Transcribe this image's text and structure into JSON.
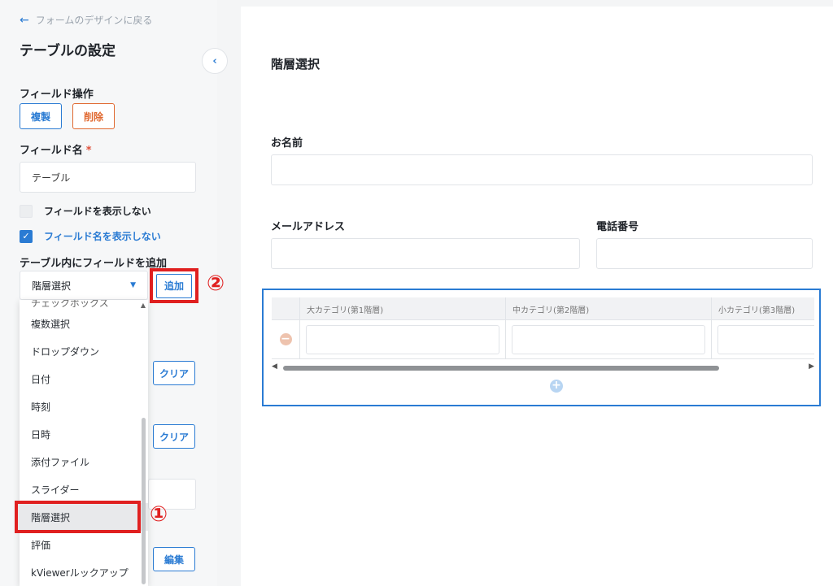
{
  "sidebar": {
    "back_link": "フォームのデザインに戻る",
    "title": "テーブルの設定",
    "field_ops_label": "フィールド操作",
    "duplicate_label": "複製",
    "delete_label": "削除",
    "field_name_label": "フィールド名",
    "required_mark": "*",
    "field_name_value": "テーブル",
    "hide_field_label": "フィールドを表示しない",
    "hide_field_name_label": "フィールド名を表示しない",
    "add_field_label": "テーブル内にフィールドを追加",
    "select_value": "階層選択",
    "add_button": "追加",
    "clear_label": "クリア",
    "edit_label": "編集",
    "dropdown_items": [
      "チェックボックス",
      "複数選択",
      "ドロップダウン",
      "日付",
      "時刻",
      "日時",
      "添付ファイル",
      "スライダー",
      "階層選択",
      "評価",
      "kViewerルックアップ"
    ],
    "annotation_1": "①",
    "annotation_2": "②"
  },
  "form": {
    "title": "階層選択",
    "name_label": "お名前",
    "email_label": "メールアドレス",
    "phone_label": "電話番号",
    "table_columns": [
      "大カテゴリ(第1階層)",
      "中カテゴリ(第2階層)",
      "小カテゴリ(第3階層)"
    ]
  },
  "colors": {
    "accent": "#2a7bd3",
    "danger": "#e0682f",
    "highlight": "#e02020"
  }
}
